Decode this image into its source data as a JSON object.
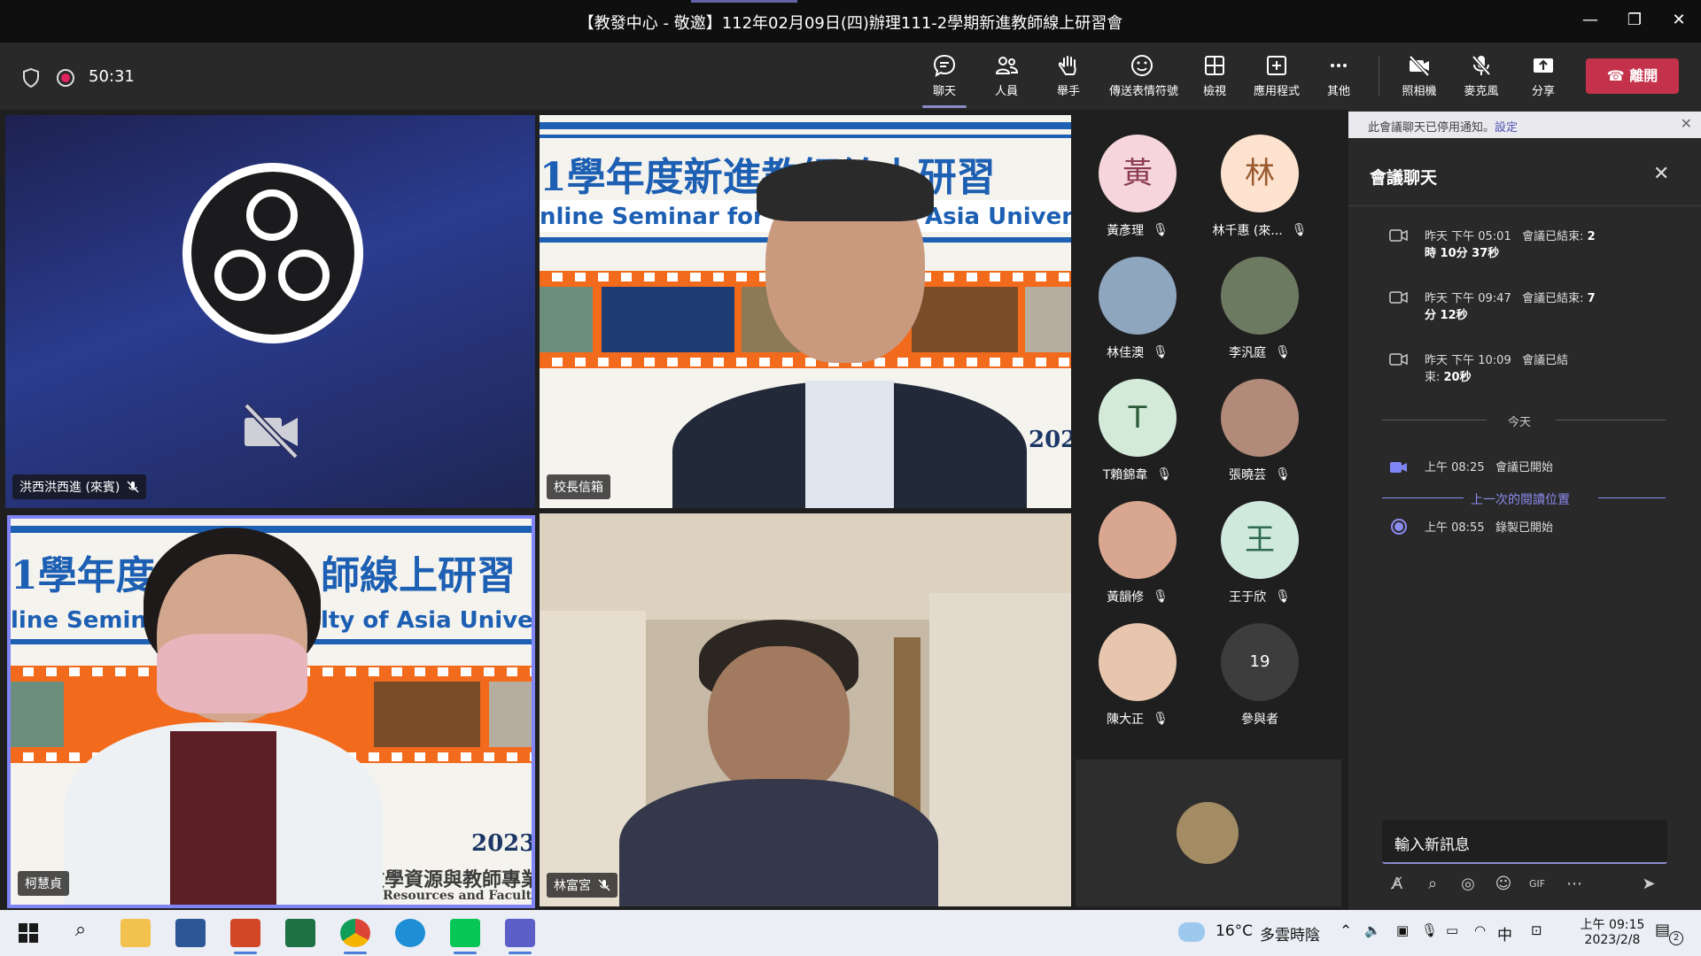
{
  "window": {
    "title": "【教發中心 - 敬邀】112年02月09日(四)辦理111-2學期新進教師線上研習會"
  },
  "meeting_toolbar": {
    "timer": "50:31",
    "buttons": [
      {
        "label": "聊天",
        "icon": "chat-icon"
      },
      {
        "label": "人員",
        "icon": "people-icon"
      },
      {
        "label": "舉手",
        "icon": "raise-hand-icon"
      },
      {
        "label": "傳送表情符號",
        "icon": "emoji-icon"
      },
      {
        "label": "檢視",
        "icon": "view-icon"
      },
      {
        "label": "應用程式",
        "icon": "apps-icon"
      },
      {
        "label": "其他",
        "icon": "more-icon"
      },
      {
        "label": "照相機",
        "icon": "camera-off-icon"
      },
      {
        "label": "麥克風",
        "icon": "mic-off-icon"
      },
      {
        "label": "分享",
        "icon": "share-icon"
      }
    ],
    "leave_label": "離開"
  },
  "video_tiles": [
    {
      "name": "洪西洪西進 (來賓)",
      "muted": true
    },
    {
      "name": "校長信箱",
      "muted": false
    },
    {
      "name": "柯慧貞",
      "muted": false
    },
    {
      "name": "林富宮",
      "muted": true
    }
  ],
  "slide": {
    "title_cn_1": "1學年度新進教師線上研習",
    "title_en_1": "nline Seminar for Ne",
    "title_en_1b": "Asia Univers",
    "year": "2023",
    "title_cn_2": "1學年度",
    "title_cn_2b": "師線上研習",
    "title_en_2": "line Semina",
    "title_en_2b": "lty of Asia Univer",
    "footer_cn": "教學資源與教師專業",
    "footer_en": "Resources and Faculty Deve"
  },
  "participants": [
    {
      "name": "黃彥理",
      "initial": "黃",
      "color": "#f6d5dd"
    },
    {
      "name": "林千惠 (來...",
      "initial": "林",
      "color": "#fde3cf"
    },
    {
      "name": "林佳澳",
      "initial": "",
      "color": "#8fa6bf"
    },
    {
      "name": "李汎庭",
      "initial": "",
      "color": "#6d7a62"
    },
    {
      "name": "T賴錦韋",
      "initial": "T",
      "color": "#d4ead9"
    },
    {
      "name": "張曉芸",
      "initial": "",
      "color": "#b28a7a"
    },
    {
      "name": "黃韻修",
      "initial": "",
      "color": "#d9a68f"
    },
    {
      "name": "王于欣",
      "initial": "王",
      "color": "#cfe9dd"
    },
    {
      "name": "陳大正",
      "initial": "",
      "color": "#e7c6ad"
    }
  ],
  "more_participants": {
    "count": "19",
    "label": "參與者"
  },
  "chat": {
    "notice": "此會議聊天已停用通知。",
    "notice_link": "設定",
    "title": "會議聊天",
    "events": [
      {
        "time": "昨天 下午 05:01",
        "text": "會議已結束: ",
        "bold": "2",
        "line2_bold": "時 10分 37秒"
      },
      {
        "time": "昨天 下午 09:47",
        "text": "會議已結束: ",
        "bold": "7",
        "line2_bold": "分 12秒"
      },
      {
        "time": "昨天 下午 10:09",
        "text": "會議已結",
        "bold": "",
        "line2": "束: ",
        "line2_bold": "20秒"
      }
    ],
    "today_label": "今天",
    "event_start": {
      "time": "上午 08:25",
      "text": "會議已開始"
    },
    "last_read": "上一次的閱讀位置",
    "event_rec": {
      "time": "上午 08:55",
      "text": "錄製已開始"
    },
    "input_placeholder": "輸入新訊息"
  },
  "taskbar": {
    "weather_temp": "16°C",
    "weather_desc": "多雲時陰",
    "ime": "中",
    "time": "上午 09:15",
    "date": "2023/2/8",
    "notification_count": "2"
  },
  "colors": {
    "teams_accent": "#6264a7",
    "leave_red": "#c4314b",
    "active_border": "#7f85f5"
  }
}
